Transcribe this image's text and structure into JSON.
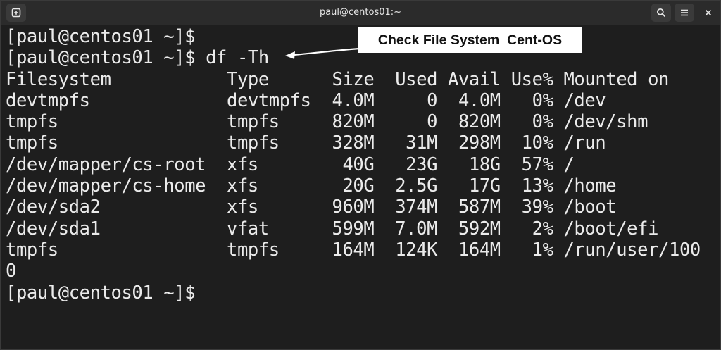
{
  "window": {
    "title": "paul@centos01:~"
  },
  "icons": {
    "new_tab": "new-tab-icon",
    "search": "search-icon",
    "menu": "hamburger-menu-icon",
    "close": "close-icon"
  },
  "callout": {
    "text": "Check File System  Cent-OS"
  },
  "terminal": {
    "lines": [
      "[paul@centos01 ~]$",
      "[paul@centos01 ~]$ df -Th",
      "Filesystem           Type      Size  Used Avail Use% Mounted on",
      "devtmpfs             devtmpfs  4.0M     0  4.0M   0% /dev",
      "tmpfs                tmpfs     820M     0  820M   0% /dev/shm",
      "tmpfs                tmpfs     328M   31M  298M  10% /run",
      "/dev/mapper/cs-root  xfs        40G   23G   18G  57% /",
      "/dev/mapper/cs-home  xfs        20G  2.5G   17G  13% /home",
      "/dev/sda2            xfs       960M  374M  587M  39% /boot",
      "/dev/sda1            vfat      599M  7.0M  592M   2% /boot/efi",
      "tmpfs                tmpfs     164M  124K  164M   1% /run/user/100",
      "0",
      "[paul@centos01 ~]$"
    ]
  }
}
